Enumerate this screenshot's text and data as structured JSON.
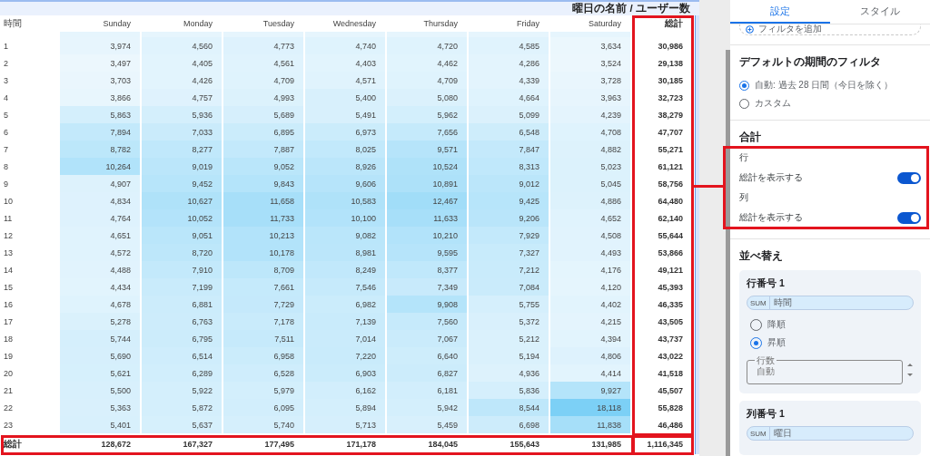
{
  "table": {
    "title": "曜日の名前 / ユーザー数",
    "columns": [
      "時間",
      "Sunday",
      "Monday",
      "Tuesday",
      "Wednesday",
      "Thursday",
      "Friday",
      "Saturday",
      "総計"
    ],
    "rows": [
      {
        "cells": [
          "1",
          "3,974",
          "4,560",
          "4,773",
          "4,740",
          "4,720",
          "4,585",
          "3,634",
          "30,986"
        ]
      },
      {
        "cells": [
          "2",
          "3,497",
          "4,405",
          "4,561",
          "4,403",
          "4,462",
          "4,286",
          "3,524",
          "29,138"
        ]
      },
      {
        "cells": [
          "3",
          "3,703",
          "4,426",
          "4,709",
          "4,571",
          "4,709",
          "4,339",
          "3,728",
          "30,185"
        ]
      },
      {
        "cells": [
          "4",
          "3,866",
          "4,757",
          "4,993",
          "5,400",
          "5,080",
          "4,664",
          "3,963",
          "32,723"
        ]
      },
      {
        "cells": [
          "5",
          "5,863",
          "5,936",
          "5,689",
          "5,491",
          "5,962",
          "5,099",
          "4,239",
          "38,279"
        ]
      },
      {
        "cells": [
          "6",
          "7,894",
          "7,033",
          "6,895",
          "6,973",
          "7,656",
          "6,548",
          "4,708",
          "47,707"
        ]
      },
      {
        "cells": [
          "7",
          "8,782",
          "8,277",
          "7,887",
          "8,025",
          "9,571",
          "7,847",
          "4,882",
          "55,271"
        ]
      },
      {
        "cells": [
          "8",
          "10,264",
          "9,019",
          "9,052",
          "8,926",
          "10,524",
          "8,313",
          "5,023",
          "61,121"
        ]
      },
      {
        "cells": [
          "9",
          "4,907",
          "9,452",
          "9,843",
          "9,606",
          "10,891",
          "9,012",
          "5,045",
          "58,756"
        ]
      },
      {
        "cells": [
          "10",
          "4,834",
          "10,627",
          "11,658",
          "10,583",
          "12,467",
          "9,425",
          "4,886",
          "64,480"
        ]
      },
      {
        "cells": [
          "11",
          "4,764",
          "10,052",
          "11,733",
          "10,100",
          "11,633",
          "9,206",
          "4,652",
          "62,140"
        ]
      },
      {
        "cells": [
          "12",
          "4,651",
          "9,051",
          "10,213",
          "9,082",
          "10,210",
          "7,929",
          "4,508",
          "55,644"
        ]
      },
      {
        "cells": [
          "13",
          "4,572",
          "8,720",
          "10,178",
          "8,981",
          "9,595",
          "7,327",
          "4,493",
          "53,866"
        ]
      },
      {
        "cells": [
          "14",
          "4,488",
          "7,910",
          "8,709",
          "8,249",
          "8,377",
          "7,212",
          "4,176",
          "49,121"
        ]
      },
      {
        "cells": [
          "15",
          "4,434",
          "7,199",
          "7,661",
          "7,546",
          "7,349",
          "7,084",
          "4,120",
          "45,393"
        ]
      },
      {
        "cells": [
          "16",
          "4,678",
          "6,881",
          "7,729",
          "6,982",
          "9,908",
          "5,755",
          "4,402",
          "46,335"
        ]
      },
      {
        "cells": [
          "17",
          "5,278",
          "6,763",
          "7,178",
          "7,139",
          "7,560",
          "5,372",
          "4,215",
          "43,505"
        ]
      },
      {
        "cells": [
          "18",
          "5,744",
          "6,795",
          "7,511",
          "7,014",
          "7,067",
          "5,212",
          "4,394",
          "43,737"
        ]
      },
      {
        "cells": [
          "19",
          "5,690",
          "6,514",
          "6,958",
          "7,220",
          "6,640",
          "5,194",
          "4,806",
          "43,022"
        ]
      },
      {
        "cells": [
          "20",
          "5,621",
          "6,289",
          "6,528",
          "6,903",
          "6,827",
          "4,936",
          "4,414",
          "41,518"
        ]
      },
      {
        "cells": [
          "21",
          "5,500",
          "5,922",
          "5,979",
          "6,162",
          "6,181",
          "5,836",
          "9,927",
          "45,507"
        ]
      },
      {
        "cells": [
          "22",
          "5,363",
          "5,872",
          "6,095",
          "5,894",
          "5,942",
          "8,544",
          "18,118",
          "55,828"
        ]
      },
      {
        "cells": [
          "23",
          "5,401",
          "5,637",
          "5,740",
          "5,713",
          "5,459",
          "6,698",
          "11,838",
          "46,486"
        ]
      }
    ],
    "totals": [
      "総計",
      "128,672",
      "167,327",
      "177,495",
      "171,178",
      "184,045",
      "155,643",
      "131,985",
      "1,116,345"
    ]
  },
  "panel": {
    "tabs": [
      {
        "label": "設定",
        "selected": true
      },
      {
        "label": "スタイル",
        "selected": false
      }
    ],
    "add_filter_button": "フィルタを追加",
    "date_filter": {
      "title": "デフォルトの期間のフィルタ",
      "options": [
        {
          "label": "自動: 過去 28 日間（今日を除く）",
          "selected": true
        },
        {
          "label": "カスタム",
          "selected": false
        }
      ]
    },
    "totals": {
      "title": "合計",
      "groups": [
        {
          "heading": "行",
          "label": "総計を表示する",
          "on": true
        },
        {
          "heading": "列",
          "label": "総計を表示する",
          "on": true
        }
      ]
    },
    "sort": {
      "title": "並べ替え",
      "cards": [
        {
          "title": "行番号 1",
          "chip_badge": "SUM",
          "chip_label": "時間",
          "options": [
            {
              "label": "降順",
              "selected": false
            },
            {
              "label": "昇順",
              "selected": true
            }
          ],
          "row_count": {
            "label": "行数",
            "value": "自動"
          }
        },
        {
          "title": "列番号 1",
          "chip_badge": "SUM",
          "chip_label": "曜日"
        }
      ]
    }
  }
}
